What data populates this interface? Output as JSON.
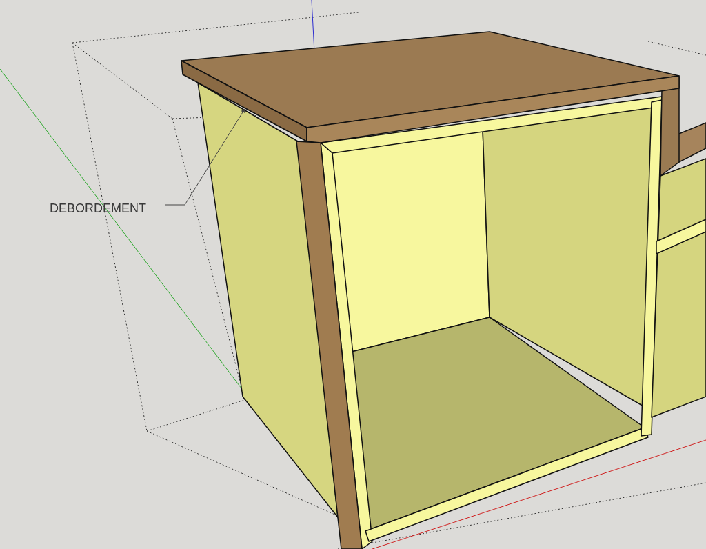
{
  "label": {
    "text": "DEBORDEMENT"
  }
}
